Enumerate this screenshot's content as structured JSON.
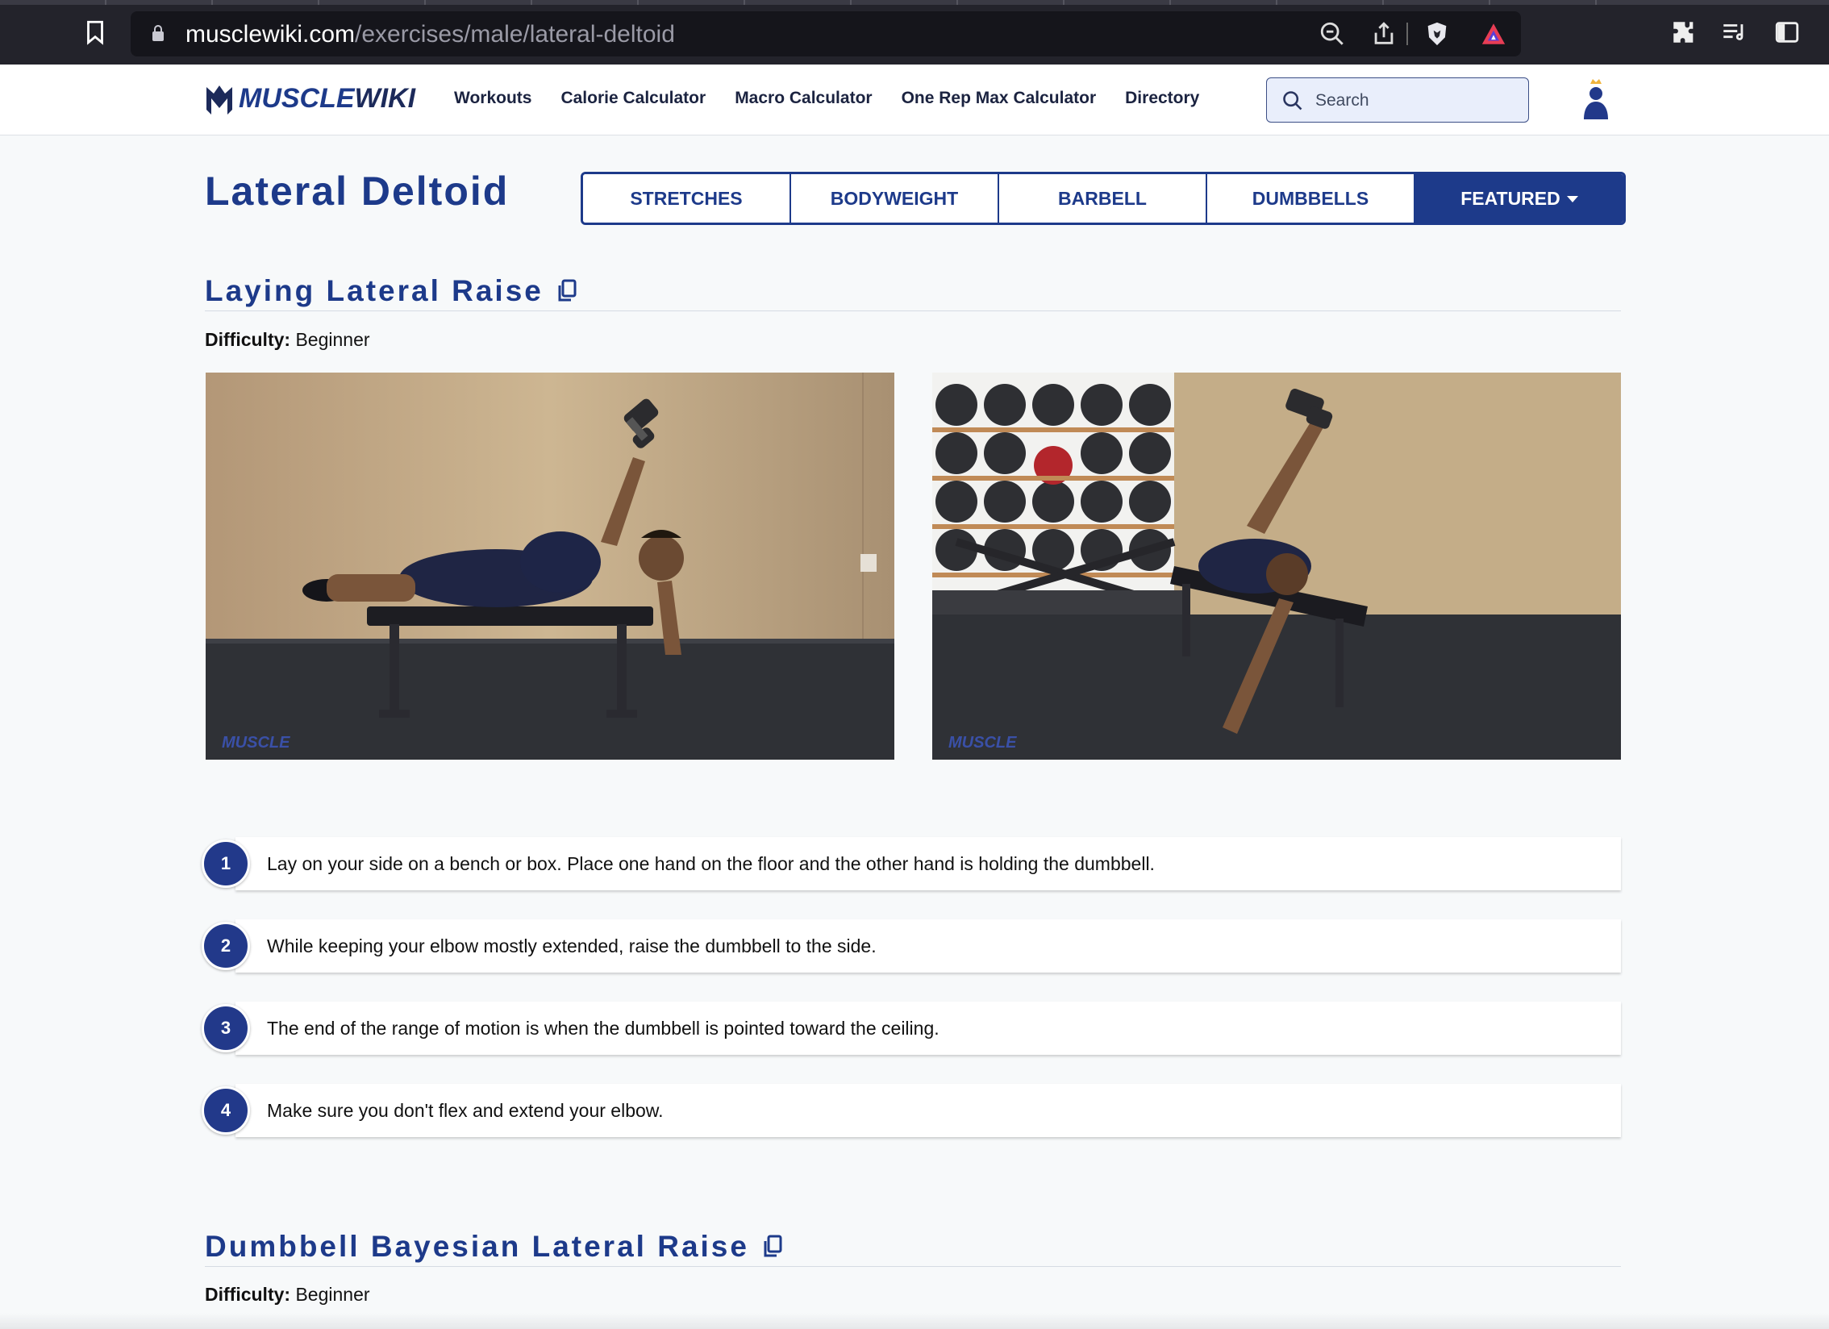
{
  "browser": {
    "url_host": "musclewiki.com",
    "url_path": "/exercises/male/lateral-deltoid"
  },
  "header": {
    "logo_text_a": "MUSCLE",
    "logo_text_b": "WIKI",
    "nav": [
      "Workouts",
      "Calorie Calculator",
      "Macro Calculator",
      "One Rep Max Calculator",
      "Directory"
    ],
    "search_placeholder": "Search"
  },
  "page": {
    "title": "Lateral Deltoid",
    "categories": [
      "STRETCHES",
      "BODYWEIGHT",
      "BARBELL",
      "DUMBBELLS",
      "FEATURED"
    ]
  },
  "exercises": [
    {
      "title": "Laying Lateral Raise",
      "difficulty_label": "Difficulty:",
      "difficulty": "Beginner",
      "steps": [
        {
          "n": "1",
          "text": "Lay on your side on a bench or box. Place one hand on the floor and the other hand is holding the dumbbell."
        },
        {
          "n": "2",
          "text": "While keeping your elbow mostly extended, raise the dumbbell to the side."
        },
        {
          "n": "3",
          "text": "The end of the range of motion is when the dumbbell is pointed toward the ceiling."
        },
        {
          "n": "4",
          "text": "Make sure you don't flex and extend your elbow."
        }
      ]
    },
    {
      "title": "Dumbbell Bayesian Lateral Raise",
      "difficulty_label": "Difficulty:",
      "difficulty": "Beginner"
    }
  ],
  "colors": {
    "brand": "#1d3a8a",
    "chrome_bg": "#23232b"
  }
}
